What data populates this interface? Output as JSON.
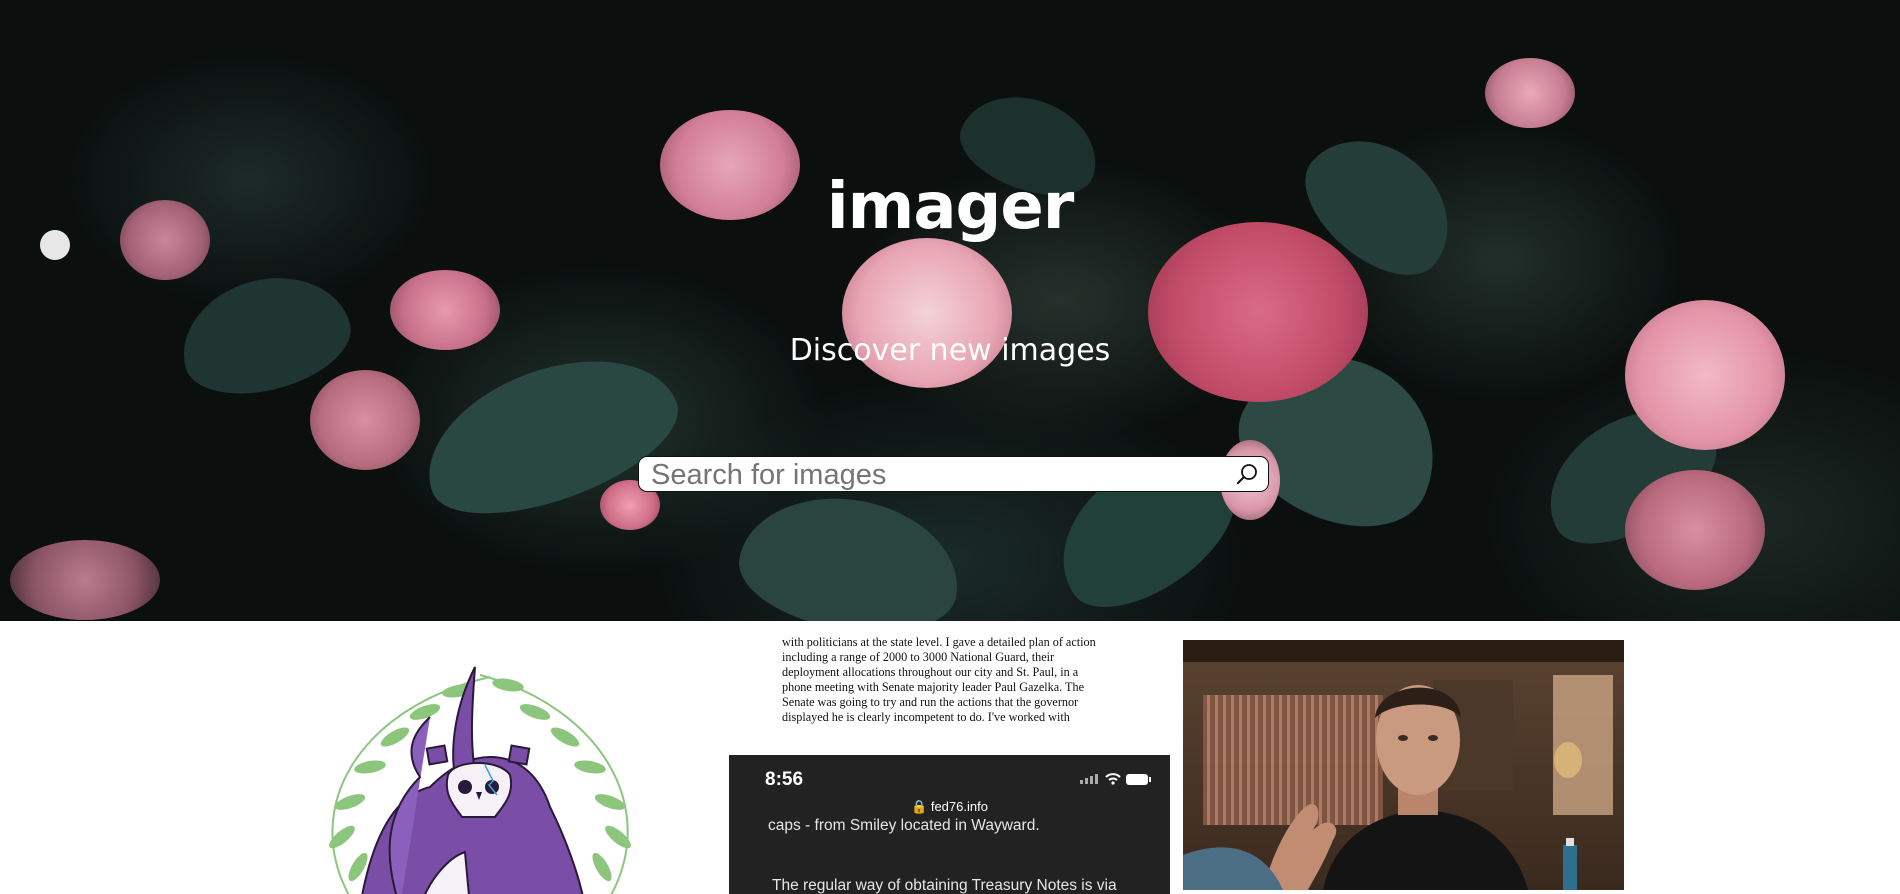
{
  "hero": {
    "title": "imager",
    "subtitle": "Discover new images",
    "search": {
      "placeholder": "Search for images",
      "icon": "search-icon"
    }
  },
  "gallery": {
    "items": [
      {
        "kind": "illustration",
        "subject": "purple-horned-skull-creature-in-laurel-wreath"
      },
      {
        "kind": "screenshot",
        "document_text": "with politicians at the state level. I gave a detailed plan of action\nincluding a range of 2000 to 3000 National Guard, their\ndeployment allocations throughout our city and St. Paul, in a\nphone meeting with Senate majority leader Paul Gazelka.  The\nSenate was going to try and run the actions that the governor\ndisplayed he is clearly incompetent to do.  I've worked with",
        "phone": {
          "time": "8:56",
          "url": "fed76.info",
          "line1": "caps - from Smiley located in Wayward.",
          "line2": "The regular way of obtaining Treasury Notes is via"
        }
      },
      {
        "kind": "photo",
        "subject": "man-talking-to-camera"
      }
    ]
  },
  "colors": {
    "hero_bg": "#0b100f",
    "pink": "#e89aab",
    "rose": "#c9506a",
    "leaf": "#3d5f57",
    "laurel": "#8cc67c",
    "purple": "#7a4ea6"
  }
}
